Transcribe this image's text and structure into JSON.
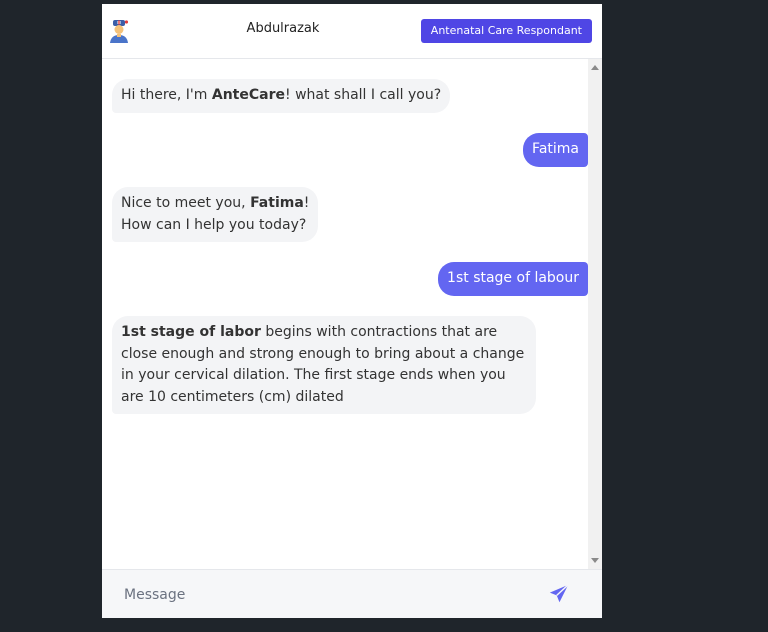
{
  "header": {
    "user_name": "Abdulrazak",
    "role_button": "Antenatal Care Respondant",
    "avatar_icon": "nurse-avatar-icon"
  },
  "messages": [
    {
      "sender": "bot",
      "parts": [
        "Hi there, I'm ",
        "AnteCare",
        "! what shall I call you?"
      ]
    },
    {
      "sender": "user",
      "text": "Fatima"
    },
    {
      "sender": "bot",
      "parts": [
        "Nice to meet you, ",
        "Fatima",
        "!",
        "How can I help you today?"
      ]
    },
    {
      "sender": "user",
      "text": "1st stage of labour"
    },
    {
      "sender": "bot",
      "parts": [
        "1st stage of labor",
        " begins with contractions that are close enough and strong enough to bring about a change in your cervical dilation. The first stage ends when you are 10 centimeters (cm) dilated"
      ]
    }
  ],
  "composer": {
    "placeholder": "Message",
    "send_icon": "paper-plane-icon"
  },
  "colors": {
    "accent": "#4f46e5",
    "user_bubble": "#6366f1",
    "bot_bubble": "#f3f4f6",
    "background": "#1f252b"
  }
}
